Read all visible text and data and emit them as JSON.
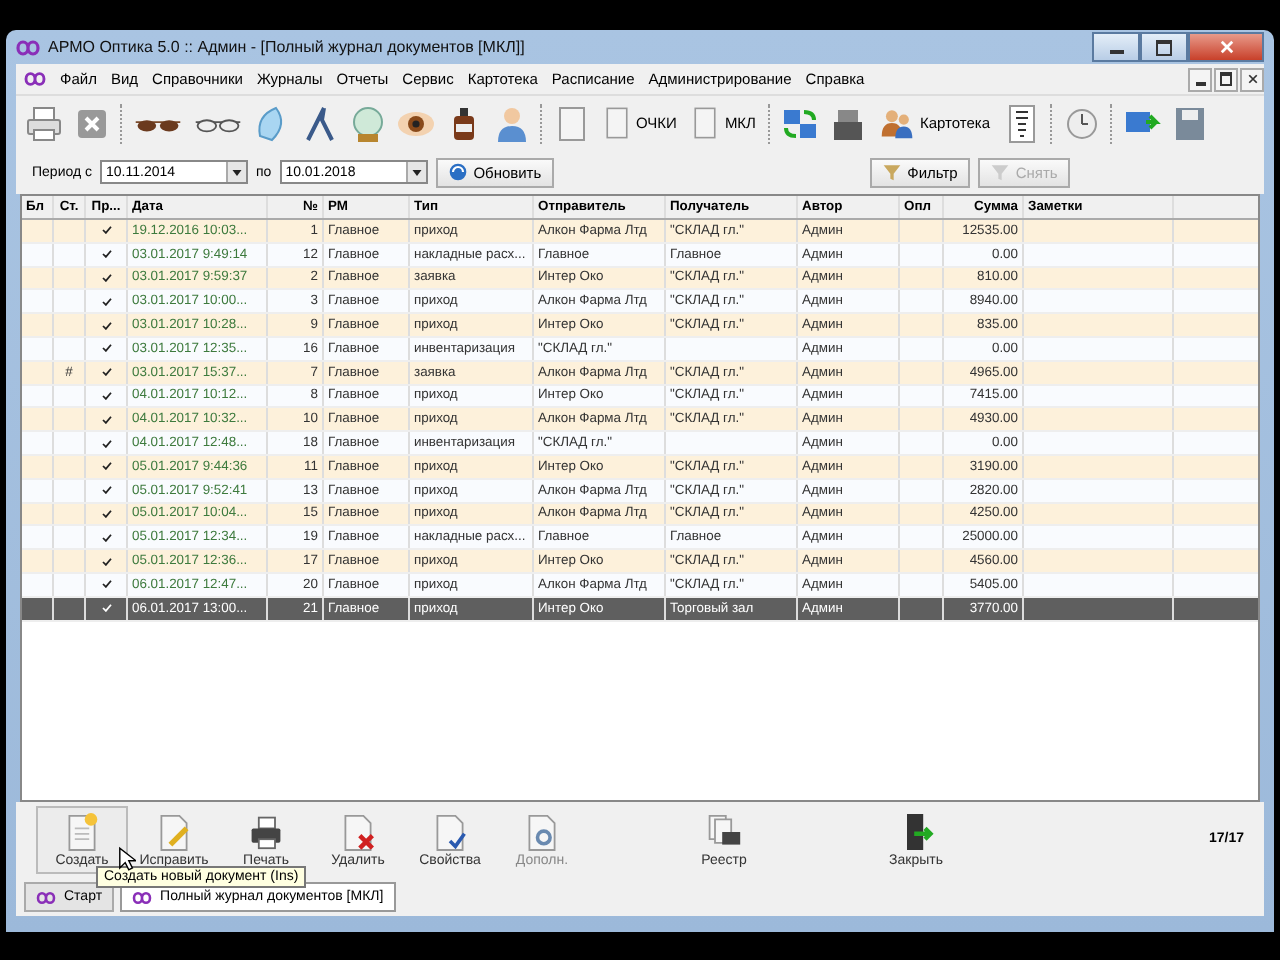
{
  "window": {
    "title": "АРМО Оптика 5.0 :: Админ - [Полный журнал документов [МКЛ]]"
  },
  "menu": [
    "Файл",
    "Вид",
    "Справочники",
    "Журналы",
    "Отчеты",
    "Сервис",
    "Картотека",
    "Расписание",
    "Администрирование",
    "Справка"
  ],
  "toolbar": {
    "labels": [
      "ОЧКИ",
      "МКЛ",
      "Картотека"
    ]
  },
  "filter": {
    "period_from_label": "Период с",
    "date_from": "10.11.2014",
    "period_to_label": "по",
    "date_to": "10.01.2018",
    "refresh": "Обновить",
    "filter": "Фильтр",
    "reset": {
      "label": "Снять",
      "disabled": true
    }
  },
  "table": {
    "columns": [
      "Бл",
      "Ст.",
      "Пр...",
      "Дата",
      "№",
      "РМ",
      "Тип",
      "Отправитель",
      "Получатель",
      "Автор",
      "Опл",
      "Сумма",
      "Заметки"
    ],
    "rows": [
      {
        "st": "",
        "posted": true,
        "date": "19.12.2016 10:03...",
        "num": "1",
        "rm": "Главное",
        "type": "приход",
        "sender": "Алкон Фарма Лтд",
        "receiver": "\"СКЛАД гл.\"",
        "author": "Админ",
        "sum": "12535.00",
        "selected": false
      },
      {
        "st": "",
        "posted": true,
        "date": "03.01.2017 9:49:14",
        "num": "12",
        "rm": "Главное",
        "type": "накладные расх...",
        "sender": "Главное",
        "receiver": "Главное",
        "author": "Админ",
        "sum": "0.00",
        "selected": false
      },
      {
        "st": "",
        "posted": true,
        "date": "03.01.2017 9:59:37",
        "num": "2",
        "rm": "Главное",
        "type": "заявка",
        "sender": "Интер Око",
        "receiver": "\"СКЛАД гл.\"",
        "author": "Админ",
        "sum": "810.00",
        "selected": false
      },
      {
        "st": "",
        "posted": true,
        "date": "03.01.2017 10:00...",
        "num": "3",
        "rm": "Главное",
        "type": "приход",
        "sender": "Алкон Фарма Лтд",
        "receiver": "\"СКЛАД гл.\"",
        "author": "Админ",
        "sum": "8940.00",
        "selected": false
      },
      {
        "st": "",
        "posted": true,
        "date": "03.01.2017 10:28...",
        "num": "9",
        "rm": "Главное",
        "type": "приход",
        "sender": "Интер Око",
        "receiver": "\"СКЛАД гл.\"",
        "author": "Админ",
        "sum": "835.00",
        "selected": false
      },
      {
        "st": "",
        "posted": true,
        "date": "03.01.2017 12:35...",
        "num": "16",
        "rm": "Главное",
        "type": "инвентаризация",
        "sender": "\"СКЛАД гл.\"",
        "receiver": "",
        "author": "Админ",
        "sum": "0.00",
        "selected": false
      },
      {
        "st": "#",
        "posted": true,
        "date": "03.01.2017 15:37...",
        "num": "7",
        "rm": "Главное",
        "type": "заявка",
        "sender": "Алкон Фарма Лтд",
        "receiver": "\"СКЛАД гл.\"",
        "author": "Админ",
        "sum": "4965.00",
        "selected": false
      },
      {
        "st": "",
        "posted": true,
        "date": "04.01.2017 10:12...",
        "num": "8",
        "rm": "Главное",
        "type": "приход",
        "sender": "Интер Око",
        "receiver": "\"СКЛАД гл.\"",
        "author": "Админ",
        "sum": "7415.00",
        "selected": false
      },
      {
        "st": "",
        "posted": true,
        "date": "04.01.2017 10:32...",
        "num": "10",
        "rm": "Главное",
        "type": "приход",
        "sender": "Алкон Фарма Лтд",
        "receiver": "\"СКЛАД гл.\"",
        "author": "Админ",
        "sum": "4930.00",
        "selected": false
      },
      {
        "st": "",
        "posted": true,
        "date": "04.01.2017 12:48...",
        "num": "18",
        "rm": "Главное",
        "type": "инвентаризация",
        "sender": "\"СКЛАД гл.\"",
        "receiver": "",
        "author": "Админ",
        "sum": "0.00",
        "selected": false
      },
      {
        "st": "",
        "posted": true,
        "date": "05.01.2017 9:44:36",
        "num": "11",
        "rm": "Главное",
        "type": "приход",
        "sender": "Интер Око",
        "receiver": "\"СКЛАД гл.\"",
        "author": "Админ",
        "sum": "3190.00",
        "selected": false
      },
      {
        "st": "",
        "posted": true,
        "date": "05.01.2017 9:52:41",
        "num": "13",
        "rm": "Главное",
        "type": "приход",
        "sender": "Алкон Фарма Лтд",
        "receiver": "\"СКЛАД гл.\"",
        "author": "Админ",
        "sum": "2820.00",
        "selected": false
      },
      {
        "st": "",
        "posted": true,
        "date": "05.01.2017 10:04...",
        "num": "15",
        "rm": "Главное",
        "type": "приход",
        "sender": "Алкон Фарма Лтд",
        "receiver": "\"СКЛАД гл.\"",
        "author": "Админ",
        "sum": "4250.00",
        "selected": false
      },
      {
        "st": "",
        "posted": true,
        "date": "05.01.2017 12:34...",
        "num": "19",
        "rm": "Главное",
        "type": "накладные расх...",
        "sender": "Главное",
        "receiver": "Главное",
        "author": "Админ",
        "sum": "25000.00",
        "selected": false
      },
      {
        "st": "",
        "posted": true,
        "date": "05.01.2017 12:36...",
        "num": "17",
        "rm": "Главное",
        "type": "приход",
        "sender": "Интер Око",
        "receiver": "\"СКЛАД гл.\"",
        "author": "Админ",
        "sum": "4560.00",
        "selected": false
      },
      {
        "st": "",
        "posted": true,
        "date": "06.01.2017 12:47...",
        "num": "20",
        "rm": "Главное",
        "type": "приход",
        "sender": "Алкон Фарма Лтд",
        "receiver": "\"СКЛАД гл.\"",
        "author": "Админ",
        "sum": "5405.00",
        "selected": false
      },
      {
        "st": "",
        "posted": true,
        "date": "06.01.2017 13:00...",
        "num": "21",
        "rm": "Главное",
        "type": "приход",
        "sender": "Интер Око",
        "receiver": "Торговый зал",
        "author": "Админ",
        "sum": "3770.00",
        "selected": true
      }
    ]
  },
  "actions": [
    {
      "label": "Создать",
      "kind": "create",
      "disabled": false
    },
    {
      "label": "Исправить",
      "kind": "edit",
      "disabled": false
    },
    {
      "label": "Печать",
      "kind": "print",
      "disabled": false
    },
    {
      "label": "Удалить",
      "kind": "delete",
      "disabled": false
    },
    {
      "label": "Свойства",
      "kind": "props",
      "disabled": false
    },
    {
      "label": "Дополн.",
      "kind": "more",
      "disabled": true
    },
    {
      "label": "Реестр",
      "kind": "registry",
      "disabled": false
    },
    {
      "label": "Закрыть",
      "kind": "close",
      "disabled": false
    }
  ],
  "record_count": "17/17",
  "tooltip": "Создать новый документ (Ins)",
  "tabs": [
    {
      "label": "Старт",
      "selected": false
    },
    {
      "label": "Полный журнал документов [МКЛ]",
      "selected": true
    }
  ]
}
